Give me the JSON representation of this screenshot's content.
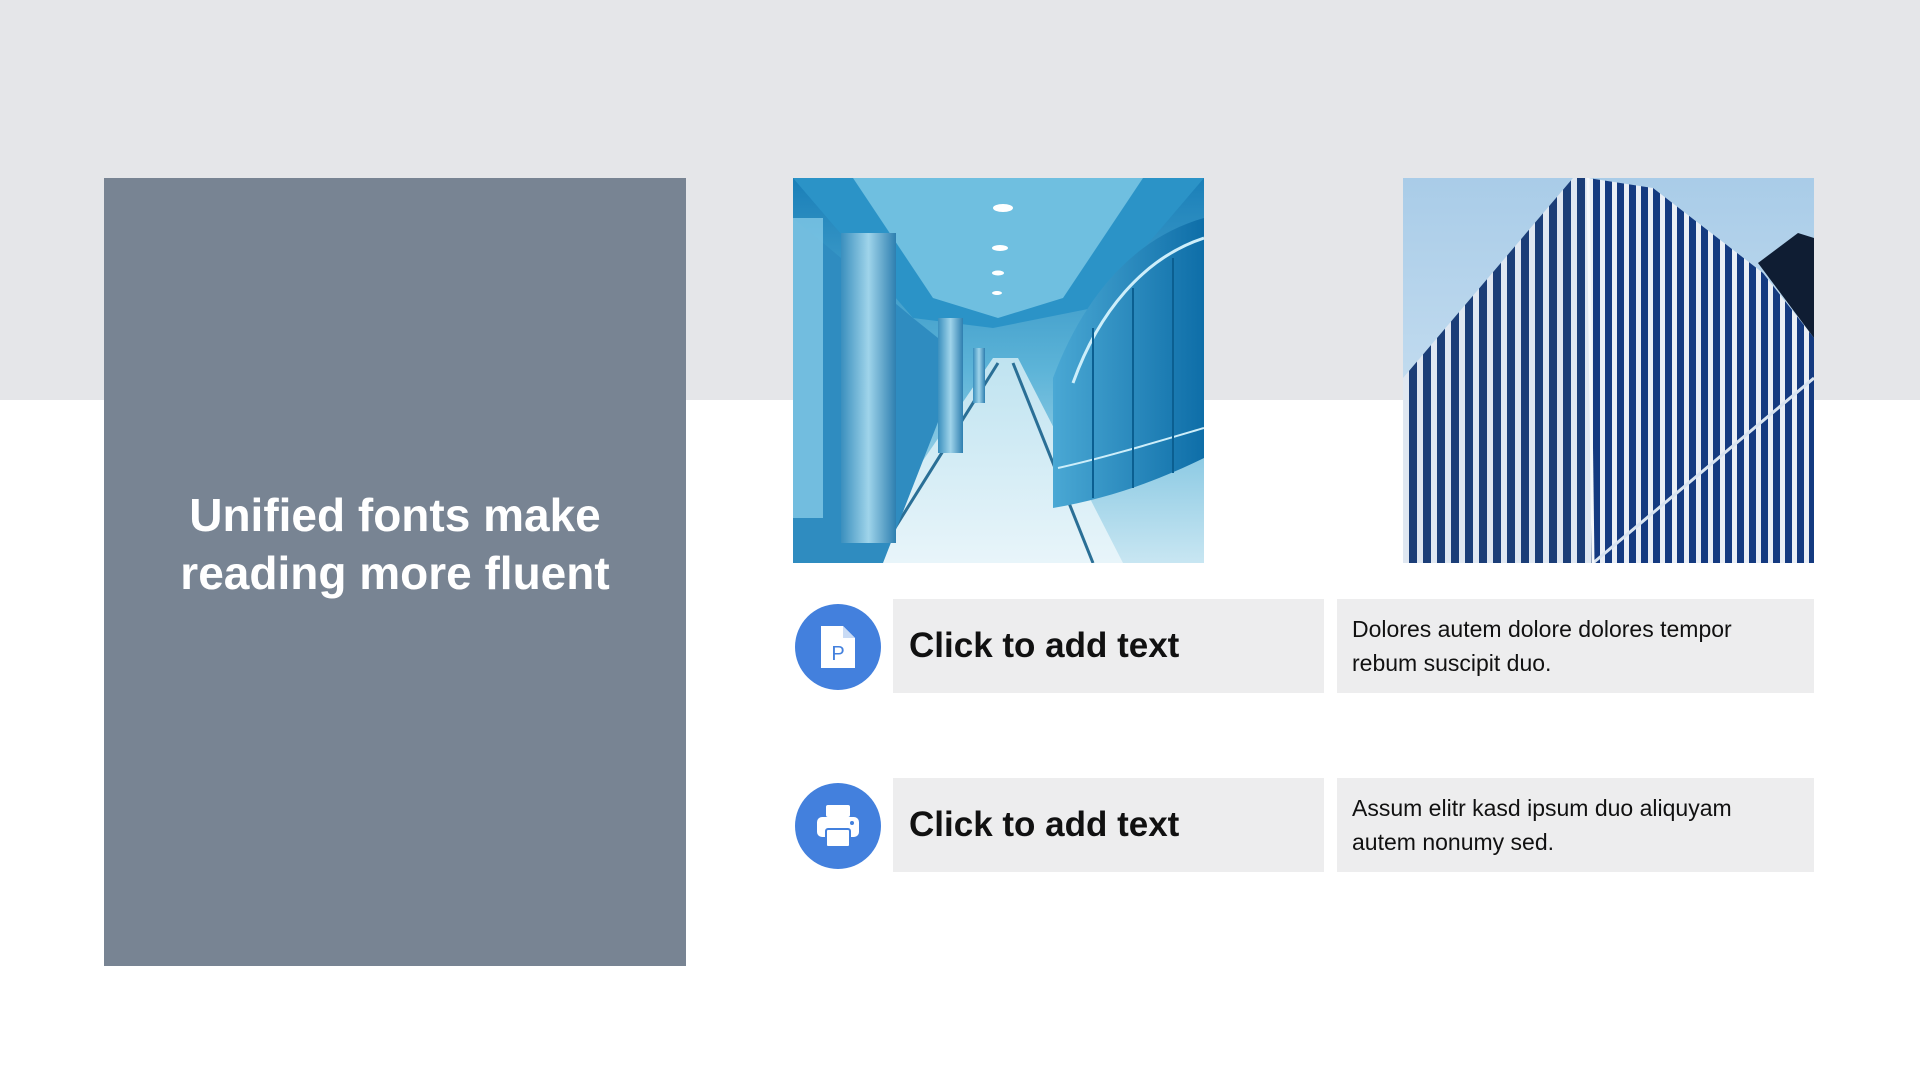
{
  "slide": {
    "title": "Unified fonts make reading more fluent",
    "colors": {
      "top_band": "#e5e6e9",
      "title_panel": "#788493",
      "icon_circle": "#4380dd",
      "text_box": "#ededee"
    }
  },
  "images": [
    {
      "name": "corridor-photo"
    },
    {
      "name": "building-photo"
    }
  ],
  "features": [
    {
      "icon": "document-p-icon",
      "title": "Click to add text",
      "description": "Dolores autem dolore dolores tempor rebum suscipit duo."
    },
    {
      "icon": "printer-icon",
      "title": "Click to add text",
      "description": "Assum elitr kasd ipsum duo aliquyam autem nonumy sed."
    }
  ]
}
